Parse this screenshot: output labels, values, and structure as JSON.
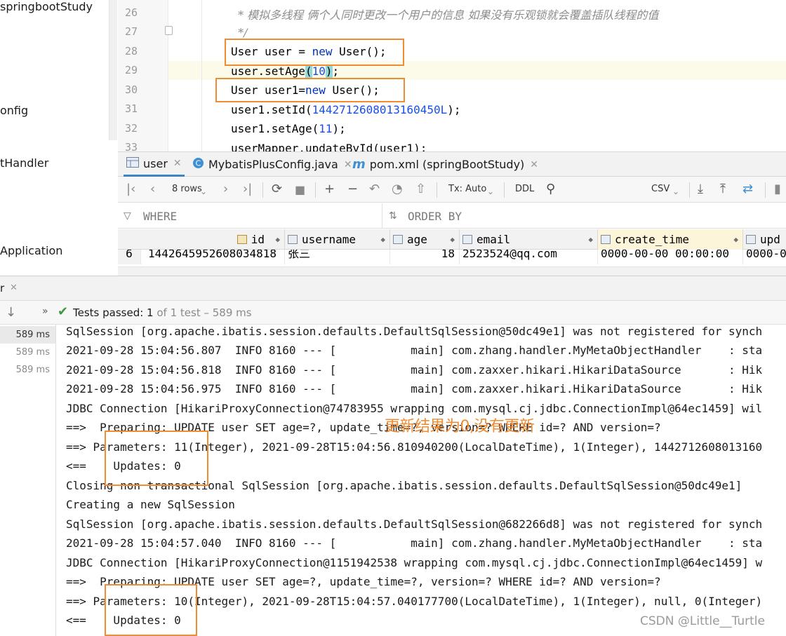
{
  "project": {
    "items": [
      "springbootStudy",
      "onfig",
      "tHandler",
      "Application"
    ]
  },
  "editor": {
    "line_numbers": [
      "26",
      "27",
      "28",
      "29",
      "30",
      "31",
      "32",
      "33"
    ],
    "comment_text": " * 模拟多线程 俩个人同时更改一个用户的信息 如果没有乐观锁就会覆盖插队线程的值",
    "comment_end": " */",
    "l28_a": "User user = ",
    "l28_kw": "new",
    "l28_b": " User();",
    "l29_a": "user.setAge",
    "l29_p1": "(",
    "l29_num": "10",
    "l29_p2": ")",
    "l29_b": ";",
    "l30_a": "User user1=",
    "l30_kw": "new",
    "l30_b": " User();",
    "l31_a": "user1.setId(",
    "l31_num": "1442712608013160450L",
    "l31_b": ");",
    "l32_a": "user1.setAge(",
    "l32_num": "11",
    "l32_b": ");",
    "l33": "userMapper.updateById(user1);"
  },
  "tabs": [
    {
      "label": "user",
      "icon": "table-icon"
    },
    {
      "label": "MybatisPlusConfig.java",
      "icon": "class-icon"
    },
    {
      "label": "pom.xml (springBootStudy)",
      "icon": "maven-icon"
    }
  ],
  "db_toolbar": {
    "rows_label": "8 rows",
    "tx_label": "Tx: Auto",
    "ddl_label": "DDL",
    "csv_label": "CSV"
  },
  "filter": {
    "where_label": "WHERE",
    "order_label": "ORDER BY"
  },
  "grid": {
    "columns": [
      "id",
      "username",
      "age",
      "email",
      "create_time",
      "upd"
    ],
    "row": {
      "index": "6",
      "id": "1442645952608034818",
      "username": "张三",
      "age": "18",
      "email": "2523524@qq.com",
      "create_time": "0000-00-00 00:00:00",
      "update_time": "0000-0"
    }
  },
  "run": {
    "tab_label": "r",
    "status_prefix": "Tests passed: ",
    "status_count": "1",
    "status_suffix": " of 1 test – 589 ms",
    "times": [
      "589 ms",
      "589 ms",
      "589 ms"
    ]
  },
  "console": {
    "lines": [
      "SqlSession [org.apache.ibatis.session.defaults.DefaultSqlSession@50dc49e1] was not registered for synch",
      "2021-09-28 15:04:56.807  INFO 8160 --- [           main] com.zhang.handler.MyMetaObjectHandler    : sta",
      "2021-09-28 15:04:56.818  INFO 8160 --- [           main] com.zaxxer.hikari.HikariDataSource       : Hik",
      "2021-09-28 15:04:56.975  INFO 8160 --- [           main] com.zaxxer.hikari.HikariDataSource       : Hik",
      "JDBC Connection [HikariProxyConnection@74783955 wrapping com.mysql.cj.jdbc.ConnectionImpl@64ec1459] wil",
      "==>  Preparing: UPDATE user SET age=?, update_time=?, version=? WHERE id=? AND version=?",
      "==> Parameters: 11(Integer), 2021-09-28T15:04:56.810940200(LocalDateTime), 1(Integer), 1442712608013160",
      "<==    Updates: 0",
      "Closing non transactional SqlSession [org.apache.ibatis.session.defaults.DefaultSqlSession@50dc49e1]",
      "Creating a new SqlSession",
      "SqlSession [org.apache.ibatis.session.defaults.DefaultSqlSession@682266d8] was not registered for synch",
      "2021-09-28 15:04:57.040  INFO 8160 --- [           main] com.zhang.handler.MyMetaObjectHandler    : sta",
      "JDBC Connection [HikariProxyConnection@1151942538 wrapping com.mysql.cj.jdbc.ConnectionImpl@64ec1459] w",
      "==>  Preparing: UPDATE user SET age=?, update_time=?, version=? WHERE id=? AND version=?",
      "==> Parameters: 10(Integer), 2021-09-28T15:04:57.040177700(LocalDateTime), 1(Integer), null, 0(Integer)",
      "<==    Updates: 0"
    ],
    "annotation": "更新结果为0,没有更新"
  },
  "watermark": "CSDN @Little__Turtle",
  "colors": {
    "highlight_box": "#f08c33",
    "keyword": "#0033b3",
    "number": "#1750eb",
    "test_pass": "#3c9a3c"
  }
}
